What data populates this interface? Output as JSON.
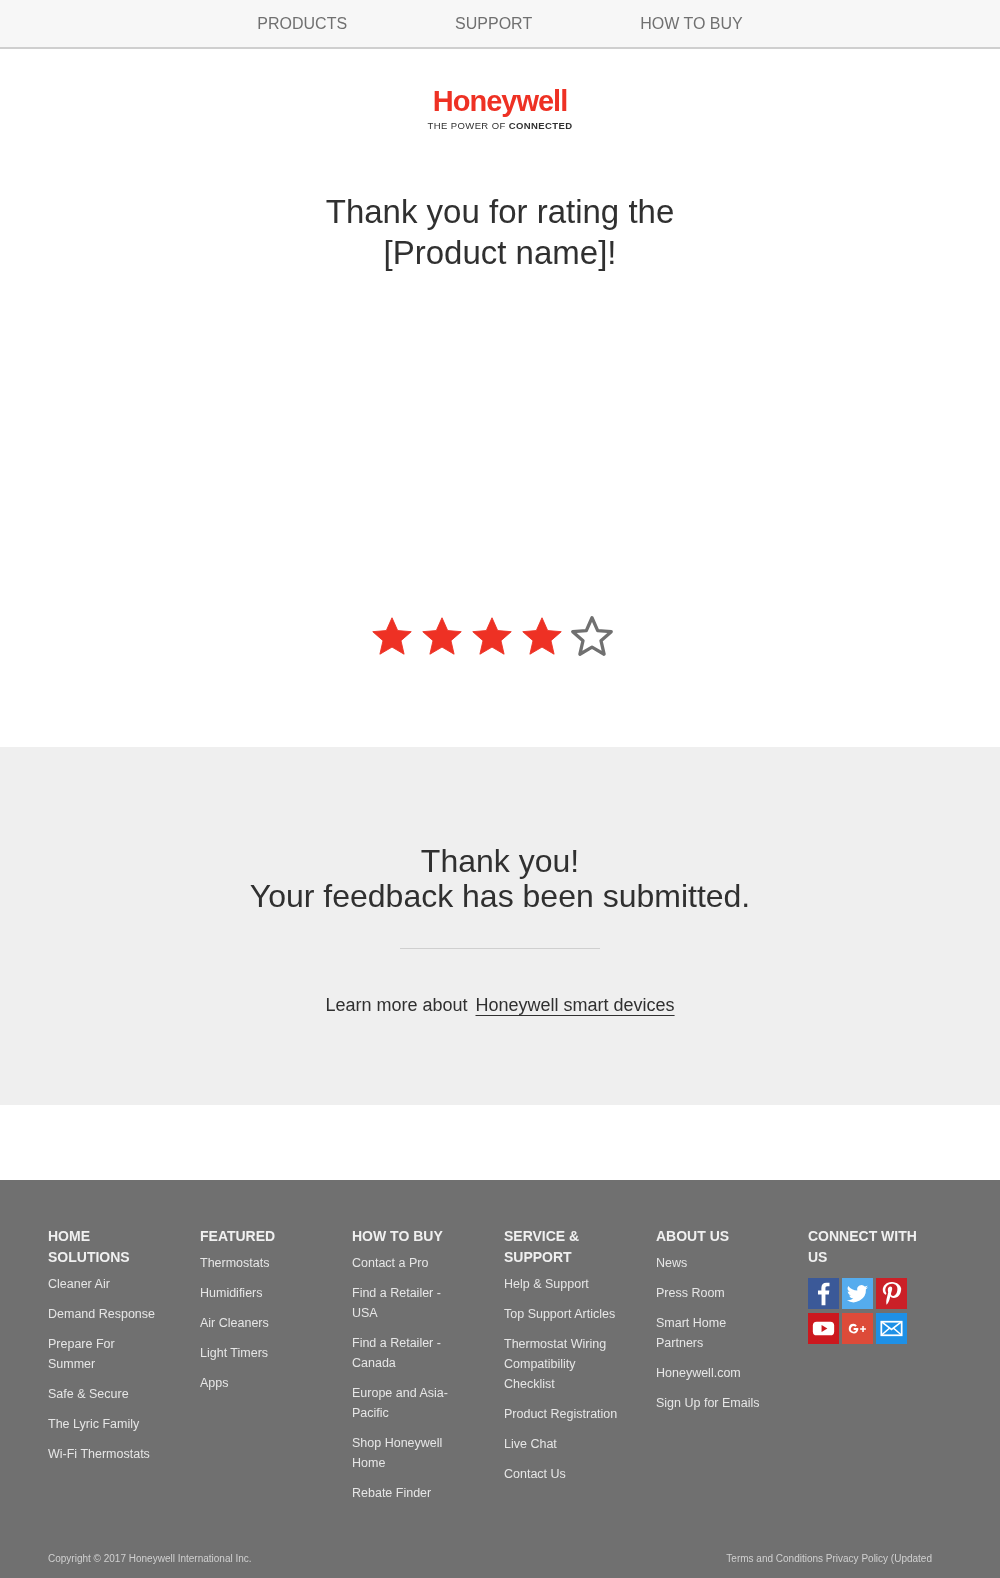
{
  "nav": [
    {
      "label": "PRODUCTS"
    },
    {
      "label": "SUPPORT"
    },
    {
      "label": "HOW TO BUY"
    }
  ],
  "logo": {
    "brand": "Honeywell",
    "tagline_plain": "THE POWER OF",
    "tagline_bold": "CONNECTED"
  },
  "heading": "Thank you for rating the [Product name]!",
  "rating": {
    "stars": 4
  },
  "confirmation": {
    "title": "Thank you!",
    "subtitle": "Your feedback has been submitted.",
    "learn_text": "Learn more about",
    "learn_link": "Honeywell smart devices"
  },
  "footer": {
    "columns": [
      {
        "heading": "HOME SOLUTIONS",
        "links": [
          "Cleaner Air",
          "Demand Response",
          "Prepare For Summer",
          "Safe & Secure",
          "The Lyric Family",
          "Wi-Fi Thermostats"
        ]
      },
      {
        "heading": "FEATURED",
        "links": [
          "Thermostats",
          "Humidifiers",
          "Air Cleaners",
          "Light Timers",
          "Apps"
        ]
      },
      {
        "heading": "HOW TO BUY",
        "links": [
          "Contact a Pro",
          "Find a Retailer - USA",
          "Find a Retailer - Canada",
          "Europe and Asia-Pacific",
          "Shop Honeywell Home",
          "Rebate Finder"
        ]
      },
      {
        "heading": "SERVICE & SUPPORT",
        "links": [
          "Help & Support",
          "Top Support Articles",
          "Thermostat Wiring Compatibility Checklist",
          "Product Registration",
          "Live Chat",
          "Contact Us"
        ]
      },
      {
        "heading": "ABOUT US",
        "links": [
          "News",
          "Press Room",
          "Smart Home Partners",
          "Honeywell.com",
          "Sign Up for Emails"
        ]
      }
    ],
    "social": {
      "heading": "CONNECT WITH US",
      "icons": [
        {
          "kind": "facebook"
        },
        {
          "kind": "twitter"
        },
        {
          "kind": "pinterest"
        },
        {
          "kind": "youtube"
        },
        {
          "kind": "googleplus"
        },
        {
          "kind": "email"
        }
      ]
    },
    "copyright": "Copyright © 2017 Honeywell International Inc.",
    "legal": "Terms and Conditions Privacy Policy (Updated"
  }
}
